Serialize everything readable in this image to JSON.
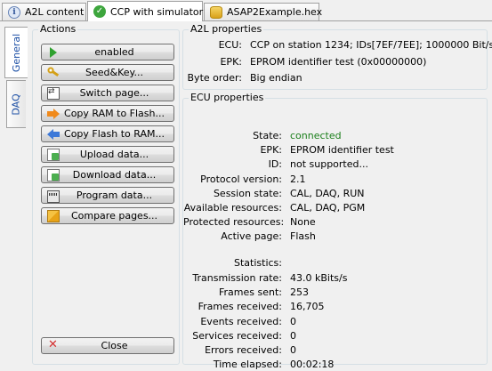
{
  "tabs": [
    {
      "label": "A2L content",
      "icon": "info-icon"
    },
    {
      "label": "CCP with simulator",
      "icon": "check-icon"
    },
    {
      "label": "ASAP2Example.hex",
      "icon": "database-icon"
    }
  ],
  "side_tabs": [
    {
      "label": "General"
    },
    {
      "label": "DAQ"
    }
  ],
  "actions": {
    "title": "Actions",
    "buttons": [
      {
        "label": "enabled",
        "icon": "play-icon"
      },
      {
        "label": "Seed&Key...",
        "icon": "key-icon"
      },
      {
        "label": "Switch page...",
        "icon": "switch-page-icon"
      },
      {
        "label": "Copy RAM to Flash...",
        "icon": "arrow-right-icon"
      },
      {
        "label": "Copy Flash to RAM...",
        "icon": "arrow-left-icon"
      },
      {
        "label": "Upload data...",
        "icon": "upload-icon"
      },
      {
        "label": "Download data...",
        "icon": "download-icon"
      },
      {
        "label": "Program data...",
        "icon": "program-icon"
      },
      {
        "label": "Compare pages...",
        "icon": "compare-icon"
      }
    ],
    "close_label": "Close"
  },
  "a2l": {
    "title": "A2L properties",
    "rows": [
      {
        "key": "ECU:",
        "value": "CCP on station 1234; IDs[7EF/7EE]; 1000000 Bit/s"
      },
      {
        "key": "EPK:",
        "value": "EPROM identifier test  (0x00000000)"
      },
      {
        "key": "Byte order:",
        "value": "Big endian"
      }
    ]
  },
  "ecu": {
    "title": "ECU properties",
    "rows": [
      {
        "key": "State:",
        "value": "connected"
      },
      {
        "key": "EPK:",
        "value": "EPROM identifier test"
      },
      {
        "key": "ID:",
        "value": "not supported..."
      },
      {
        "key": "Protocol version:",
        "value": "2.1"
      },
      {
        "key": "Session state:",
        "value": "CAL, DAQ, RUN"
      },
      {
        "key": "Available resources:",
        "value": "CAL, DAQ, PGM"
      },
      {
        "key": "Protected resources:",
        "value": "None"
      },
      {
        "key": "Active page:",
        "value": "Flash"
      }
    ],
    "statistics_label": "Statistics:",
    "stats": [
      {
        "key": "Transmission rate:",
        "value": "43.0 kBits/s"
      },
      {
        "key": "Frames sent:",
        "value": "253"
      },
      {
        "key": "Frames received:",
        "value": "16,705"
      },
      {
        "key": "Events received:",
        "value": "0"
      },
      {
        "key": "Services received:",
        "value": "0"
      },
      {
        "key": "Errors received:",
        "value": "0"
      },
      {
        "key": "Time elapsed:",
        "value": "00:02:18"
      }
    ]
  },
  "colors": {
    "state_connected": "#1a7f1a",
    "side_tab_text": "#1c4fa5"
  }
}
